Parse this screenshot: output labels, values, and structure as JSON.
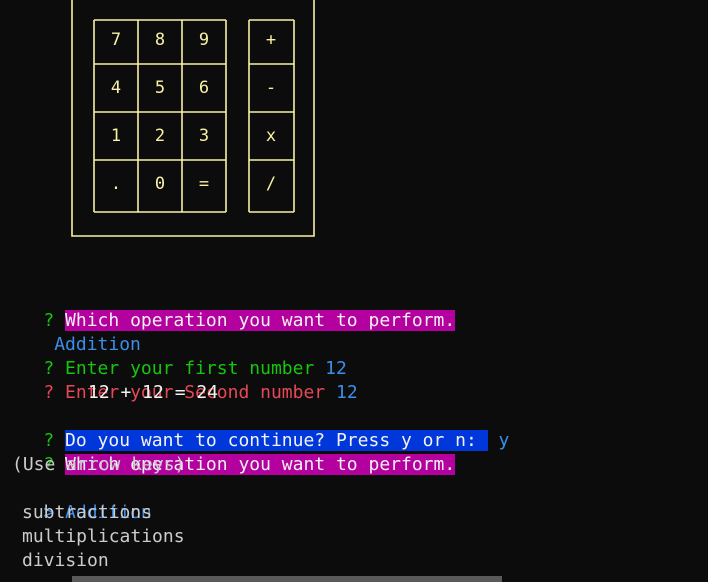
{
  "calculator_art": {
    "keys": [
      [
        "7",
        "8",
        "9",
        "+"
      ],
      [
        "4",
        "5",
        "6",
        "-"
      ],
      [
        "1",
        "2",
        "3",
        "x"
      ],
      [
        ".",
        "0",
        "=",
        "/"
      ]
    ]
  },
  "session": {
    "prompt_marker": "?",
    "q1": "Which operation you want to perform.",
    "a1": "Addition",
    "q2": "Enter your first number",
    "a2": "12",
    "q3": "Enter your Second number",
    "a3": "12",
    "result": "12 + 12 = 24",
    "q4": "Do you want to continue? Press y or n: ",
    "a4": "y",
    "q5": "Which operation you want to perform.",
    "hint": "(Use arrow keys)",
    "cursor": ">",
    "options": [
      "Addition",
      "subtractions",
      "multiplications",
      "division"
    ]
  },
  "colors": {
    "background": "#0c0c0c",
    "art": "#f9f1a5",
    "magenta_highlight": "#b4009e",
    "blue_highlight": "#0037da",
    "green": "#16c60c",
    "red": "#e74856",
    "cyan": "#3b8eea"
  }
}
